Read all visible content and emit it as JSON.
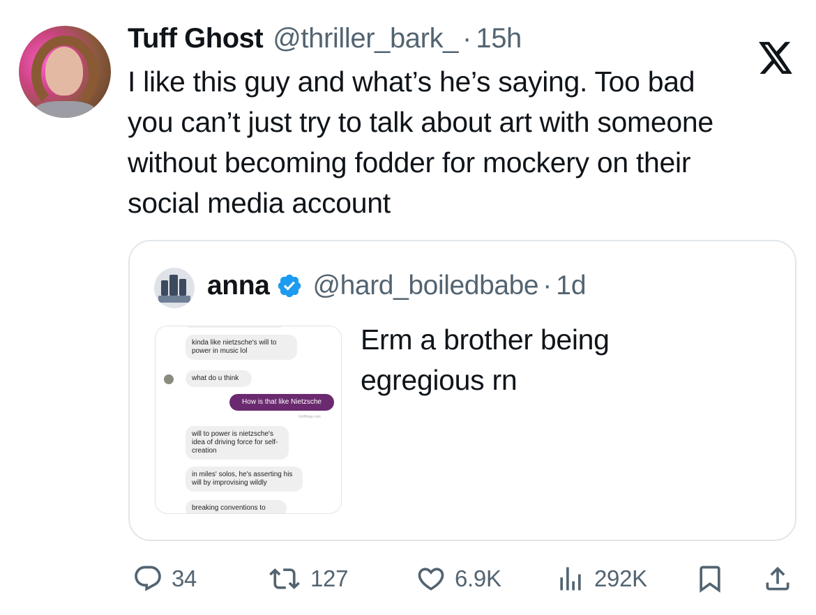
{
  "post": {
    "author_name": "Tuff Ghost",
    "author_handle": "@thriller_bark_",
    "separator": "·",
    "time": "15h",
    "text": "I like this guy and what’s he’s saying. Too bad\nyou can’t just try to talk about art with someone\nwithout becoming fodder for mockery on their\nsocial media account"
  },
  "quote": {
    "author_name": "anna",
    "author_handle": "@hard_boiledbabe",
    "separator": "·",
    "time": "1d",
    "text": "Erm a brother being\negregious rn",
    "image_chat": {
      "messages": [
        "kinda like nietzsche's will to power in music lol",
        "what do u think",
        "How is that like Nietzsche",
        "will to power is nietzsche's idea of driving force for self-creation",
        "in miles' solos, he's asserting his will by improvising wildly",
        "breaking conventions to"
      ],
      "source": "GirlHinge.com"
    }
  },
  "actions": {
    "replies": "34",
    "reposts": "127",
    "likes": "6.9K",
    "views": "292K"
  },
  "icons": {
    "logo": "x-logo-icon",
    "verified": "verified-badge-icon",
    "reply": "reply-icon",
    "repost": "repost-icon",
    "like": "like-icon",
    "views": "views-icon",
    "bookmark": "bookmark-icon",
    "share": "share-icon"
  },
  "colors": {
    "text_primary": "#0f1419",
    "text_secondary": "#536471",
    "verified_blue": "#1d9bf0",
    "border": "#e1e6ea"
  }
}
